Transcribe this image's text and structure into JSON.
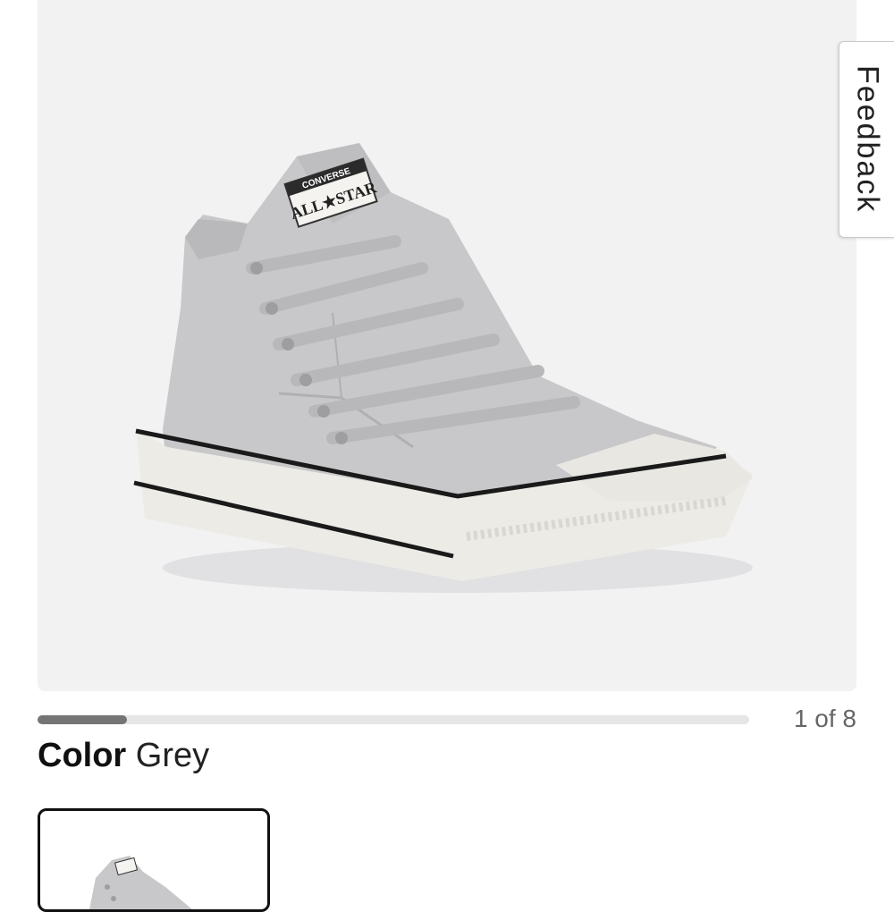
{
  "gallery": {
    "image_label": "CONVERSE ALL STAR",
    "image_index": 1,
    "image_total": 8,
    "counter_text": "1 of 8",
    "progress_fraction": 0.125
  },
  "feedback": {
    "label": "Feedback"
  },
  "color": {
    "label": "Color",
    "value": "Grey"
  },
  "colors": {
    "track": "#e6e6e6",
    "fill": "#757575",
    "shoe": "#c8c7c9",
    "sole": "#ecebe6"
  },
  "icons": {
    "shoe": "sneaker-image",
    "swatch": "sneaker-thumbnail"
  }
}
